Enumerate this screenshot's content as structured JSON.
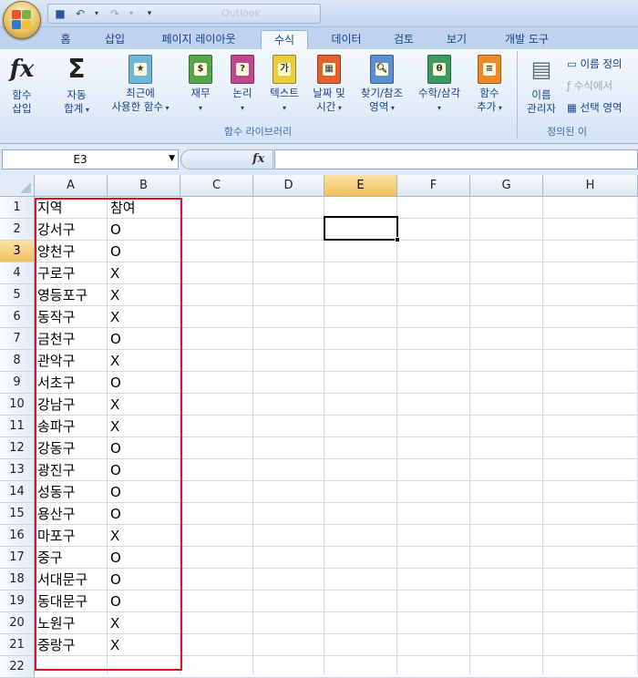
{
  "app": {
    "title": "Outlook"
  },
  "tabs": [
    "홈",
    "삽입",
    "페이지 레이아웃",
    "수식",
    "데이터",
    "검토",
    "보기",
    "개발 도구"
  ],
  "active_tab": "수식",
  "ribbon": {
    "insert_function": "함수\n삽입",
    "autosum": "자동\n합계",
    "recent": "최근에\n사용한 함수",
    "finance": "재무",
    "logical": "논리",
    "text": "텍스트",
    "datetime": "날짜 및\n시간",
    "lookup": "찾기/참조\n영역",
    "math": "수학/삼각",
    "more": "함수\n추가",
    "group1_label": "함수 라이브러리",
    "name_manager": "이름\n관리자",
    "define_name": "이름 정의",
    "use_in_formula": "수식에서",
    "create_from_selection": "선택 영역",
    "group2_label": "정의된 이"
  },
  "formula_bar": {
    "name_box": "E3",
    "fx": "fx",
    "content": ""
  },
  "columns": [
    "A",
    "B",
    "C",
    "D",
    "E",
    "F",
    "G",
    "H"
  ],
  "selected_column": "E",
  "selected_row": 3,
  "rows": [
    {
      "n": "1",
      "a": "지역",
      "b": "참여"
    },
    {
      "n": "2",
      "a": "강서구",
      "b": "O"
    },
    {
      "n": "3",
      "a": "양천구",
      "b": "O"
    },
    {
      "n": "4",
      "a": "구로구",
      "b": "X"
    },
    {
      "n": "5",
      "a": "영등포구",
      "b": "X"
    },
    {
      "n": "6",
      "a": "동작구",
      "b": "X"
    },
    {
      "n": "7",
      "a": "금천구",
      "b": "O"
    },
    {
      "n": "8",
      "a": "관악구",
      "b": "X"
    },
    {
      "n": "9",
      "a": "서초구",
      "b": "O"
    },
    {
      "n": "10",
      "a": "강남구",
      "b": "X"
    },
    {
      "n": "11",
      "a": "송파구",
      "b": "X"
    },
    {
      "n": "12",
      "a": "강동구",
      "b": "O"
    },
    {
      "n": "13",
      "a": "광진구",
      "b": "O"
    },
    {
      "n": "14",
      "a": "성동구",
      "b": "O"
    },
    {
      "n": "15",
      "a": "용산구",
      "b": "O"
    },
    {
      "n": "16",
      "a": "마포구",
      "b": "X"
    },
    {
      "n": "17",
      "a": "중구",
      "b": "O"
    },
    {
      "n": "18",
      "a": "서대문구",
      "b": "O"
    },
    {
      "n": "19",
      "a": "동대문구",
      "b": "O"
    },
    {
      "n": "20",
      "a": "노원구",
      "b": "X"
    },
    {
      "n": "21",
      "a": "중랑구",
      "b": "X"
    },
    {
      "n": "22",
      "a": "",
      "b": ""
    }
  ],
  "colors": {
    "highlight_box": "#e2111f",
    "ribbon_text": "#15428b"
  }
}
